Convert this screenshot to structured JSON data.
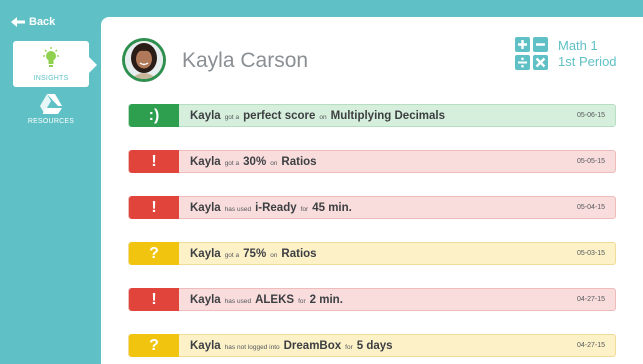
{
  "nav": {
    "back_label": "Back",
    "insights_label": "INSIGHTS",
    "resources_label": "RESOURCES"
  },
  "student": {
    "name": "Kayla Carson"
  },
  "class": {
    "name": "Math 1",
    "period": "1st Period"
  },
  "feed": [
    {
      "status": "success",
      "badge": ":)",
      "name": "Kayla",
      "verb": "got a",
      "value": "perfect score",
      "prep": "on",
      "target": "Multiplying Decimals",
      "date": "05-06-15"
    },
    {
      "status": "alert",
      "badge": "!",
      "name": "Kayla",
      "verb": "got a",
      "value": "30%",
      "prep": "on",
      "target": "Ratios",
      "date": "05-05-15"
    },
    {
      "status": "alert",
      "badge": "!",
      "name": "Kayla",
      "verb": "has used",
      "value": "i-Ready",
      "prep": "for",
      "target": "45 min.",
      "date": "05-04-15"
    },
    {
      "status": "warning",
      "badge": "?",
      "name": "Kayla",
      "verb": "got a",
      "value": "75%",
      "prep": "on",
      "target": "Ratios",
      "date": "05-03-15"
    },
    {
      "status": "alert",
      "badge": "!",
      "name": "Kayla",
      "verb": "has used",
      "value": "ALEKS",
      "prep": "for",
      "target": "2 min.",
      "date": "04-27-15"
    },
    {
      "status": "warning",
      "badge": "?",
      "name": "Kayla",
      "verb": "has not logged into",
      "value": "DreamBox",
      "prep": "for",
      "target": "5 days",
      "date": "04-27-15"
    }
  ],
  "colors": {
    "accent": "#5fc1c6",
    "success": "#2e9e4f",
    "alert": "#e0443a",
    "warning": "#f1c40f"
  }
}
